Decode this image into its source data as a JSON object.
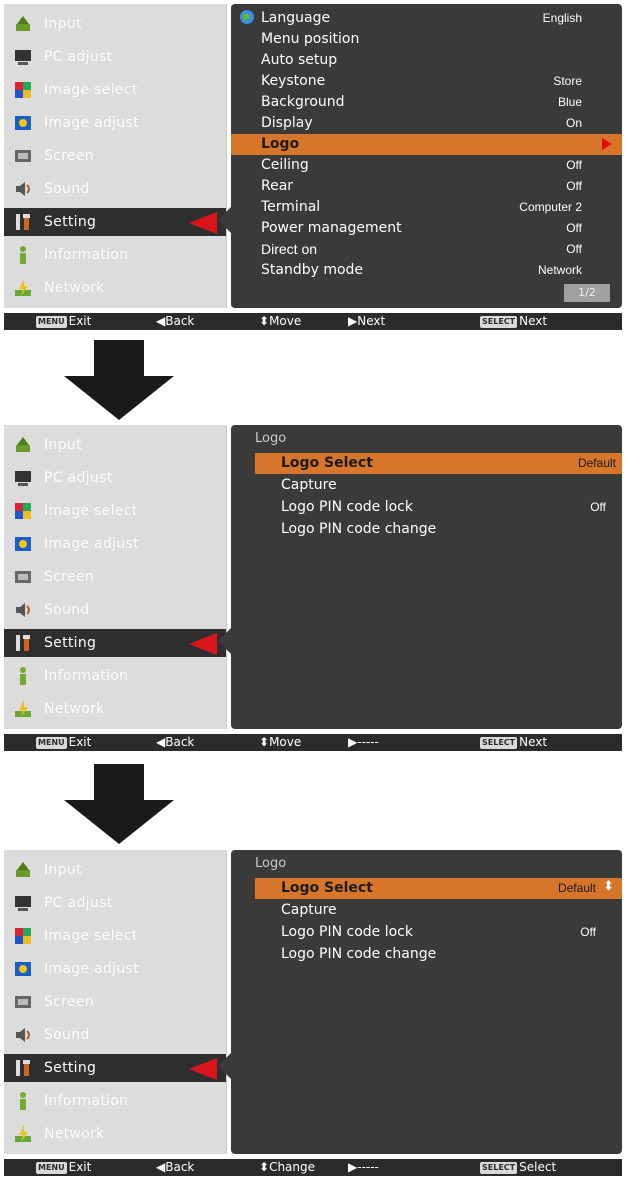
{
  "sidebar": [
    {
      "label": "Input",
      "icon": "input-icon"
    },
    {
      "label": "PC adjust",
      "icon": "pc-adjust-icon"
    },
    {
      "label": "Image select",
      "icon": "image-select-icon"
    },
    {
      "label": "Image adjust",
      "icon": "image-adjust-icon"
    },
    {
      "label": "Screen",
      "icon": "screen-icon"
    },
    {
      "label": "Sound",
      "icon": "sound-icon"
    },
    {
      "label": "Setting",
      "icon": "setting-icon"
    },
    {
      "label": "Information",
      "icon": "information-icon"
    },
    {
      "label": "Network",
      "icon": "network-icon"
    }
  ],
  "screen1": {
    "rows": [
      {
        "label": "Language",
        "value": "English"
      },
      {
        "label": "Menu position",
        "value": ""
      },
      {
        "label": "Auto setup",
        "value": ""
      },
      {
        "label": "Keystone",
        "value": "Store"
      },
      {
        "label": "Background",
        "value": "Blue"
      },
      {
        "label": "Display",
        "value": "On"
      },
      {
        "label": "Logo",
        "value": ""
      },
      {
        "label": "Ceiling",
        "value": "Off"
      },
      {
        "label": "Rear",
        "value": "Off"
      },
      {
        "label": "Terminal",
        "value": "Computer 2"
      },
      {
        "label": "Power management",
        "value": "Off"
      },
      {
        "label": "Direct on",
        "value": "Off"
      },
      {
        "label": "Standby mode",
        "value": "Network"
      }
    ],
    "page": "1/2",
    "status": {
      "exit": "Exit",
      "back": "Back",
      "move": "Move",
      "next": "Next",
      "select_next": "Next",
      "menu_key": "MENU",
      "select_key": "SELECT"
    }
  },
  "screen2": {
    "title": "Logo",
    "rows": [
      {
        "label": "Logo Select",
        "value": "Default"
      },
      {
        "label": "Capture",
        "value": ""
      },
      {
        "label": "Logo PIN code lock",
        "value": "Off"
      },
      {
        "label": "Logo PIN code change",
        "value": ""
      }
    ],
    "status": {
      "exit": "Exit",
      "back": "Back",
      "move": "Move",
      "next": "-----",
      "select_next": "Next",
      "menu_key": "MENU",
      "select_key": "SELECT"
    }
  },
  "screen3": {
    "title": "Logo",
    "rows": [
      {
        "label": "Logo Select",
        "value": "Default"
      },
      {
        "label": "Capture",
        "value": ""
      },
      {
        "label": "Logo PIN code lock",
        "value": "Off"
      },
      {
        "label": "Logo PIN code change",
        "value": ""
      }
    ],
    "status": {
      "exit": "Exit",
      "back": "Back",
      "move": "Change",
      "next": "-----",
      "select_next": "Select",
      "menu_key": "MENU",
      "select_key": "SELECT"
    }
  },
  "colors": {
    "accent": "#d7752a",
    "panel": "#3a3a3a",
    "sidebar": "#dcdcdc",
    "arrow": "#d9151b"
  }
}
